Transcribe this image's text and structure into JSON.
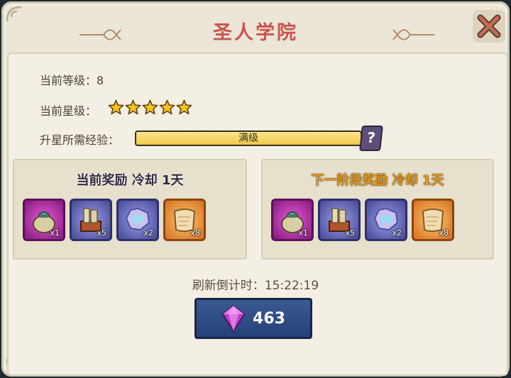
{
  "window": {
    "title": "圣人学院",
    "close_icon": "close-x-icon"
  },
  "stats": {
    "level_label": "当前等级：",
    "level_value": "8",
    "star_label": "当前星级：",
    "star_count": 5,
    "xp_label": "升星所需经验：",
    "xp_bar_text": "满级",
    "xp_fill_fraction": 1.0,
    "help_label": "?"
  },
  "rewards": {
    "current": {
      "title": "当前奖励  冷却  1天",
      "items": [
        {
          "icon": "sack-icon",
          "rarity": "purple",
          "qty": "x1"
        },
        {
          "icon": "scroll-chest-icon",
          "rarity": "blue",
          "qty": "x5"
        },
        {
          "icon": "water-rune-icon",
          "rarity": "blue",
          "qty": "x2"
        },
        {
          "icon": "parchment-icon",
          "rarity": "orange",
          "qty": "x8"
        }
      ]
    },
    "next": {
      "title": "下一阶段奖励  冷却  1天",
      "items": [
        {
          "icon": "sack-icon",
          "rarity": "purple",
          "qty": "x1"
        },
        {
          "icon": "scroll-chest-icon",
          "rarity": "blue",
          "qty": "x5"
        },
        {
          "icon": "water-rune-icon",
          "rarity": "blue",
          "qty": "x2"
        },
        {
          "icon": "parchment-icon",
          "rarity": "orange",
          "qty": "x8"
        }
      ]
    }
  },
  "refresh": {
    "label": "刷新倒计时：",
    "time": "15:22:19"
  },
  "gem_button": {
    "icon": "gem-icon",
    "value": "463"
  },
  "colors": {
    "title": "#c9544f",
    "next_reward_title": "#e59b1a",
    "button_bg": "#26417a",
    "xp_bar": "#efc94b"
  }
}
